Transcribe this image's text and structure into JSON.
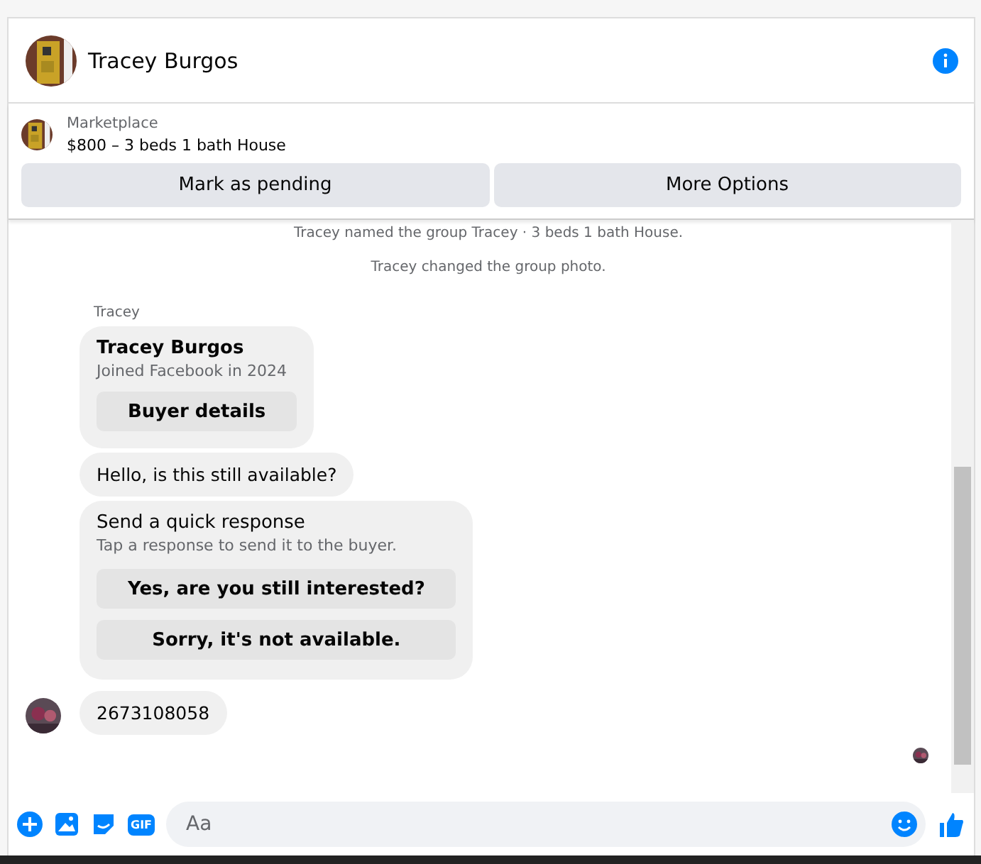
{
  "header": {
    "title": "Tracey Burgos"
  },
  "listing": {
    "label": "Marketplace",
    "title": "$800 – 3 beds 1 bath House",
    "actions": [
      "Mark as pending",
      "More Options"
    ]
  },
  "events": [
    "Tracey named the group Tracey · 3 beds 1 bath House.",
    "Tracey changed the group photo."
  ],
  "sender": "Tracey",
  "profile_card": {
    "name": "Tracey Burgos",
    "subtitle": "Joined Facebook in 2024",
    "button": "Buyer details"
  },
  "message": "Hello, is this still available?",
  "quick_response": {
    "title": "Send a quick response",
    "subtitle": "Tap a response to send it to the buyer.",
    "options": [
      "Yes, are you still interested?",
      "Sorry, it's not available."
    ]
  },
  "last_message": "2673108058",
  "composer": {
    "placeholder": "Aa",
    "gif_label": "GIF"
  }
}
